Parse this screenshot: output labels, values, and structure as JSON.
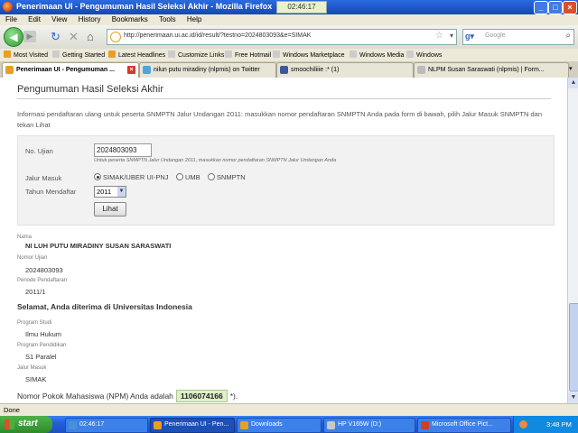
{
  "window": {
    "title": "Penerimaan UI - Pengumuman Hasil Seleksi Akhir - Mozilla Firefox",
    "clock_overlay": "02:46:17",
    "buttons": {
      "minimize": "_",
      "maximize": "□",
      "close": "×"
    }
  },
  "menu": [
    "File",
    "Edit",
    "View",
    "History",
    "Bookmarks",
    "Tools",
    "Help"
  ],
  "nav": {
    "url": "http://penerimaan.ui.ac.id/id/result/?testno=2024803093&e=SIMAK",
    "search_placeholder": "Google"
  },
  "bookmarks": [
    "Most Visited",
    "Getting Started",
    "Latest Headlines",
    "Customize Links",
    "Free Hotmail",
    "Windows Marketplace",
    "Windows Media",
    "Windows"
  ],
  "tabs": [
    {
      "label": "Penerimaan UI - Pengumuman ...",
      "active": true,
      "color": "#e8a020"
    },
    {
      "label": "nilun putu miradiny (nlpmis) on Twitter",
      "active": false,
      "color": "#4aa8e0"
    },
    {
      "label": "smoochiliiie :* (1)",
      "active": false,
      "color": "#3b5998"
    },
    {
      "label": "NLPM Susan Saraswati (nlpmis) | Form...",
      "active": false,
      "color": "#888888"
    }
  ],
  "page": {
    "title": "Pengumuman Hasil Seleksi Akhir",
    "info": "Informasi pendaftaran ulang untuk peserta SNMPTN Jalur Undangan 2011: masukkan nomor pendaftaran SNMPTN Anda pada form di bawah, pilih Jalur Masuk SNMPTN dan tekan Lihat",
    "form": {
      "no_ujian_label": "No. Ujian",
      "no_ujian_value": "2024803093",
      "hint": "Untuk peserta  SNMPTN Jalur Undangan 2011, masukkan nomor pendaftaran SNMPTN Jalur Undangan Anda",
      "jalur_label": "Jalur Masuk",
      "jalur_options": [
        "SIMAK/UBER UI-PNJ",
        "UMB",
        "SNMPTN"
      ],
      "jalur_selected": 0,
      "tahun_label": "Tahun Mendaftar",
      "tahun_value": "2011",
      "submit_label": "Lihat"
    },
    "result": {
      "nama_label": "Nama",
      "nama_value": "NI LUH PUTU MIRADINY SUSAN SARASWATI",
      "nomor_label": "Nomor Ujian",
      "nomor_value": "2024803093",
      "periode_label": "Periode Pendaftaran",
      "periode_value": "2011/1",
      "congrats": "Selamat, Anda diterima di Universitas Indonesia",
      "prodi_label": "Program Studi",
      "prodi_value": "Ilmu Hukum",
      "pendidikan_label": "Program Pendidikan",
      "pendidikan_value": "S1 Paralel",
      "jalur_label": "Jalur Masuk",
      "jalur_value": "SIMAK",
      "npm_prefix": "Nomor Pokok Mahasiswa (NPM) Anda adalah",
      "npm_value": "1106074166",
      "npm_suffix": "*)."
    }
  },
  "status": "Done",
  "taskbar": {
    "start": "start",
    "tasks": [
      {
        "label": "02:46:17",
        "color": "#4a90d9"
      },
      {
        "label": "Penerimaan UI - Pen...",
        "color": "#e8a020"
      },
      {
        "label": "Downloads",
        "color": "#e8a020"
      },
      {
        "label": "HP V165W (D:)",
        "color": "#c8c8c8"
      },
      {
        "label": "Microsoft Office Pict...",
        "color": "#d04020"
      }
    ],
    "clock": "3:48 PM"
  }
}
